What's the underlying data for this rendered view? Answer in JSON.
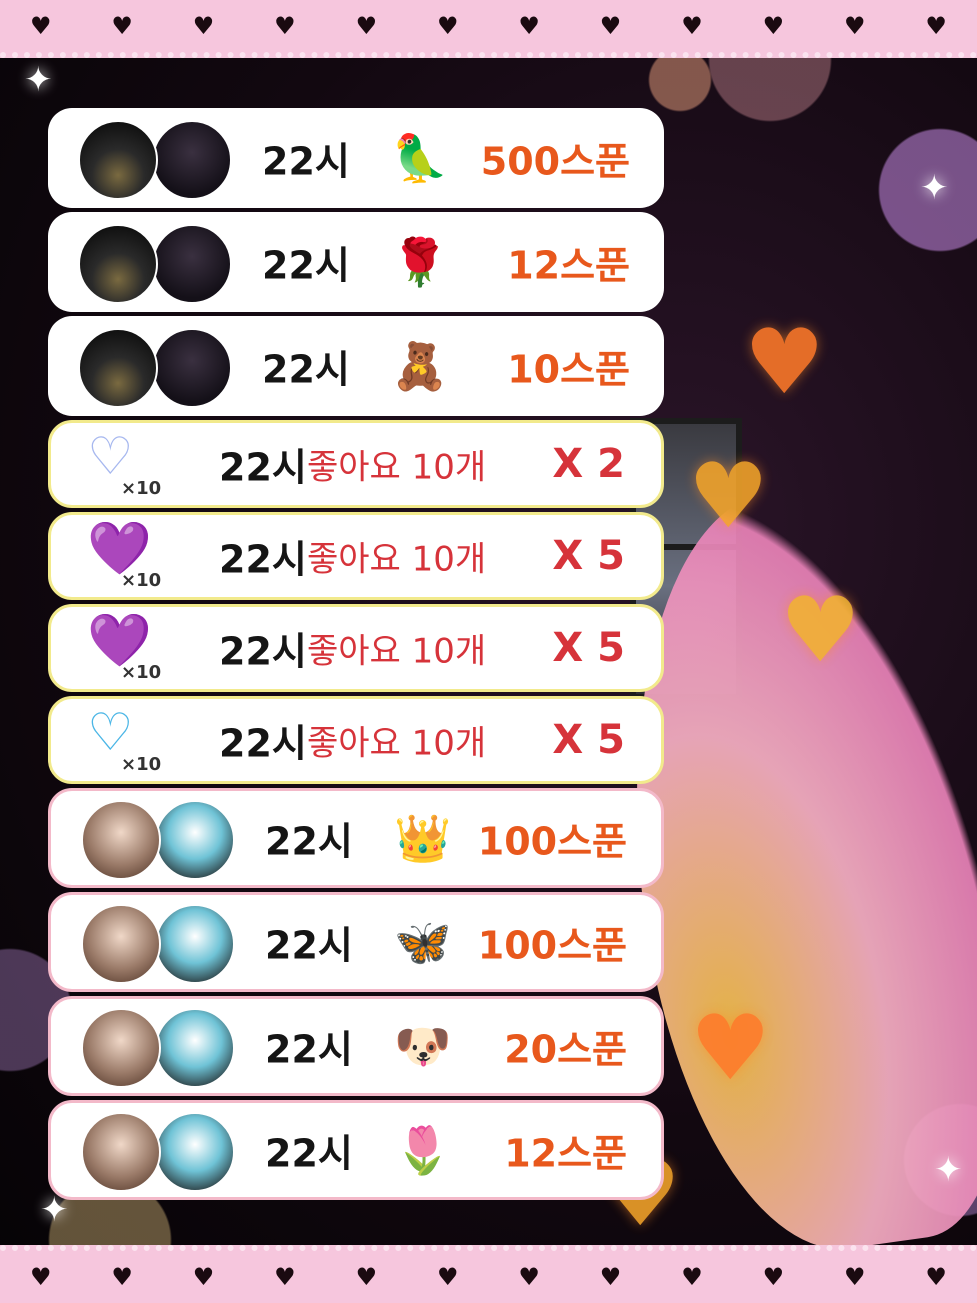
{
  "decor": {
    "lace_heart": "♥",
    "big_heart": "♥",
    "sparkle": "✦"
  },
  "gift_rows": [
    {
      "time": "22시",
      "gift_icon": "parrot-icon",
      "gift_glyph": "🦜",
      "amount": "500스푼",
      "avatars": "night-city"
    },
    {
      "time": "22시",
      "gift_icon": "rose-icon",
      "gift_glyph": "🌹",
      "amount": "12스푼",
      "avatars": "night-city"
    },
    {
      "time": "22시",
      "gift_icon": "teddy-bear-icon",
      "gift_glyph": "🧸",
      "amount": "10스푼",
      "avatars": "night-city"
    }
  ],
  "like_rows": [
    {
      "time": "22시",
      "text": "좋아요 10개",
      "mult": "X 2",
      "badge": "×10",
      "heart_icon": "flower-heart-icon",
      "heart_glyph": "♡",
      "heart_color": "#a7b8ef"
    },
    {
      "time": "22시",
      "text": "좋아요 10개",
      "mult": "X 5",
      "badge": "×10",
      "heart_icon": "purple-heart-icon",
      "heart_glyph": "💜",
      "heart_color": "#9b62c4"
    },
    {
      "time": "22시",
      "text": "좋아요 10개",
      "mult": "X 5",
      "badge": "×10",
      "heart_icon": "purple-heart-icon",
      "heart_glyph": "💜",
      "heart_color": "#9b62c4"
    },
    {
      "time": "22시",
      "text": "좋아요 10개",
      "mult": "X 5",
      "badge": "×10",
      "heart_icon": "blue-heart-icon",
      "heart_glyph": "♡",
      "heart_color": "#4bb6e6"
    }
  ],
  "gift_rows_2": [
    {
      "time": "22시",
      "gift_icon": "crown-icon",
      "gift_glyph": "👑",
      "amount": "100스푼",
      "avatars": "girl-sky"
    },
    {
      "time": "22시",
      "gift_icon": "butterfly-icon",
      "gift_glyph": "🦋",
      "amount": "100스푼",
      "avatars": "girl-sky"
    },
    {
      "time": "22시",
      "gift_icon": "puppy-balloon-icon",
      "gift_glyph": "🐶",
      "amount": "20스푼",
      "avatars": "girl-sky"
    },
    {
      "time": "22시",
      "gift_icon": "pink-rose-icon",
      "gift_glyph": "🌷",
      "amount": "12스푼",
      "avatars": "girl-sky"
    }
  ],
  "colors": {
    "amount": "#e8581c",
    "like_red": "#d6333a",
    "lace_pink": "#f6c6dd"
  }
}
